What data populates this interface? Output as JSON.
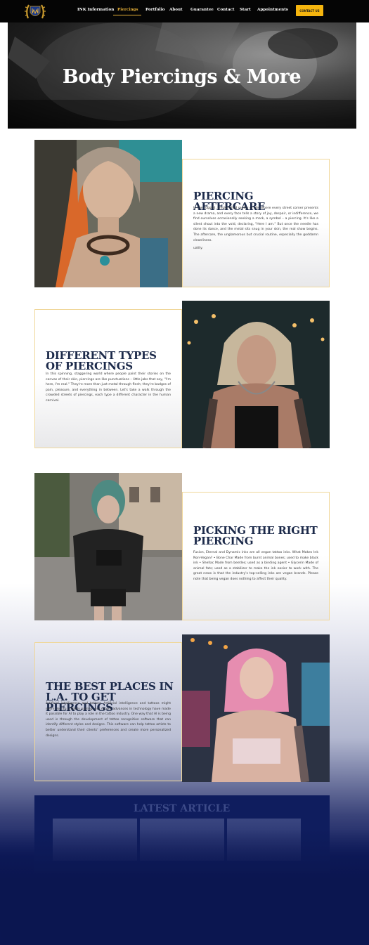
{
  "nav": {
    "items": [
      {
        "label": "INK Information"
      },
      {
        "label": "Piercings"
      },
      {
        "label": "Portfolio"
      },
      {
        "label": "About"
      },
      {
        "label": "Guarantee"
      },
      {
        "label": "Contact"
      },
      {
        "label": "Start"
      },
      {
        "label": "Appointments"
      }
    ],
    "active": "Piercings",
    "cta_label": "CONTACT US"
  },
  "hero": {
    "title": "Body Piercings & More"
  },
  "sections": [
    {
      "title": "PIERCING AFTERCARE",
      "body": "In the rugged, smoke-filled reality of life, where every street corner presents a new drama, and every face tells a story of joy, despair, or indifference, we find ourselves occasionally seeking a mark, a symbol – a piercing. It's like a silent shout into the void, declaring, \"Here I am.\" But once the needle has done its dance, and the metal sits snug in your skin, the real show begins. The aftercare, the unglamorous but crucial routine, especially the goddamn cleanliness.",
      "extra": "uality."
    },
    {
      "title": "DIFFERENT TYPES OF PIERCINGS",
      "body": "In this spinning, staggering world where people paint their stories on the canvas of their skin, piercings are like punctuations – little jabs that say, \"I'm here, I'm real.\" They're more than just metal through flesh; they're badges of pain, pleasure, and everything in between. Let's take a walk through the crowded streets of piercings, each type a different character in the human carnival."
    },
    {
      "title": "PICKING THE RIGHT PIERCING",
      "body": "Fusion, Eternal and Dynamic inks are all vegan tattoo inks. What Makes Ink Non-Vegan? • Bone Char Made from burnt animal bones; used to make black ink • Shellac Made from beetles; used as a binding agent • Glycerin Made of animal fats; used as a stabilizer to make the ink easier to work with. The great news is that the industry's top-selling inks are vegan brands. Please note that being vegan does nothing to affect their quality."
    },
    {
      "title": "THE BEST PLACES IN L.A. TO GET PIERCINGS",
      "body": "Artificial intelligence and tattoos Artificial intelligence and tattoos might seem like an unlikely pairing, but recent advances in technology have made it possible for AI to play a role in the tattoo industry. One way that AI is being used is through the development of tattoo recognition software that can identify different styles and designs. This software can help tattoo artists to better understand their clients' preferences and create more personalized designs."
    }
  ],
  "latest": {
    "title": "LATEST ARTICLE"
  },
  "colors": {
    "accent": "#f5b50e",
    "navy": "#1c2a4a",
    "nav_bg": "#050505",
    "footer_bg": "#0b1650"
  }
}
